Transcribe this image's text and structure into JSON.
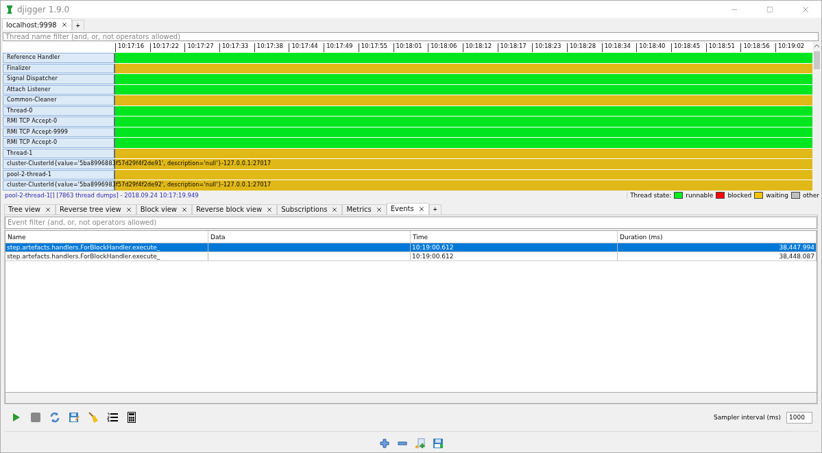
{
  "window": {
    "title": "djigger 1.9.0"
  },
  "session_tabs": [
    {
      "label": "localhost:9998",
      "selected": true
    }
  ],
  "add_tab": "+",
  "thread_filter": {
    "placeholder": "Thread name filter (and, or, not operators allowed)"
  },
  "timeline": {
    "ticks": [
      "10:17:16",
      "10:17:22",
      "10:17:27",
      "10:17:33",
      "10:17:38",
      "10:17:44",
      "10:17:49",
      "10:17:55",
      "10:18:01",
      "10:18:06",
      "10:18:12",
      "10:18:17",
      "10:18:23",
      "10:18:28",
      "10:18:34",
      "10:18:40",
      "10:18:45",
      "10:18:51",
      "10:18:56",
      "10:19:02"
    ]
  },
  "threads": [
    {
      "name": "Reference Handler",
      "color": "#00e61e"
    },
    {
      "name": "Finalizer",
      "color": "#e0b818"
    },
    {
      "name": "Signal Dispatcher",
      "color": "#00e61e"
    },
    {
      "name": "Attach Listener",
      "color": "#00e61e"
    },
    {
      "name": "Common-Cleaner",
      "color": "#e0b818"
    },
    {
      "name": "Thread-0",
      "color": "#00e61e"
    },
    {
      "name": "RMI TCP Accept-0",
      "color": "#00e61e"
    },
    {
      "name": "RMI TCP Accept-9999",
      "color": "#00e61e"
    },
    {
      "name": "RMI TCP Accept-0",
      "color": "#00e61e"
    },
    {
      "name": "Thread-1",
      "color": "#e0b818"
    },
    {
      "name": "cluster-ClusterId{value='5ba8996883f57d29f4f2de91', description='null'}-127.0.0.1:27017",
      "color": "#e0b818"
    },
    {
      "name": "pool-2-thread-1",
      "color": "#e0b818"
    },
    {
      "name": "cluster-ClusterId{value='5ba8996983f57d29f4f2de92', description='null'}-127.0.0.1:27017",
      "color": "#e0b818"
    }
  ],
  "status": {
    "selection": "pool-2-thread-1[] [7863 thread dumps] - 2018.09.24 10:17:19.949",
    "legend_title": "Thread state:",
    "legend": [
      {
        "label": "runnable",
        "color": "#00ee22"
      },
      {
        "label": "blocked",
        "color": "#ff0000"
      },
      {
        "label": "waiting",
        "color": "#f5c400"
      },
      {
        "label": "other",
        "color": "#c0c0c0"
      }
    ]
  },
  "view_tabs": [
    {
      "label": "Tree view",
      "selected": false
    },
    {
      "label": "Reverse tree view",
      "selected": false
    },
    {
      "label": "Block view",
      "selected": false
    },
    {
      "label": "Reverse block view",
      "selected": false
    },
    {
      "label": "Subscriptions",
      "selected": false
    },
    {
      "label": "Metrics",
      "selected": false
    },
    {
      "label": "Events",
      "selected": true
    }
  ],
  "event_filter": {
    "placeholder": "Event filter (and, or, not operators allowed)"
  },
  "events_table": {
    "columns": [
      "Name",
      "Data",
      "Time",
      "Duration (ms)"
    ],
    "rows": [
      {
        "cells": [
          "step.artefacts.handlers.ForBlockHandler.execute_",
          "",
          "10:19:00.612",
          "38,447.994"
        ],
        "selected": true
      },
      {
        "cells": [
          "step.artefacts.handlers.ForBlockHandler.execute_",
          "",
          "10:19:00.612",
          "38,448.087"
        ],
        "selected": false
      }
    ]
  },
  "sampler": {
    "label": "Sampler interval (ms)",
    "value": "1000"
  }
}
